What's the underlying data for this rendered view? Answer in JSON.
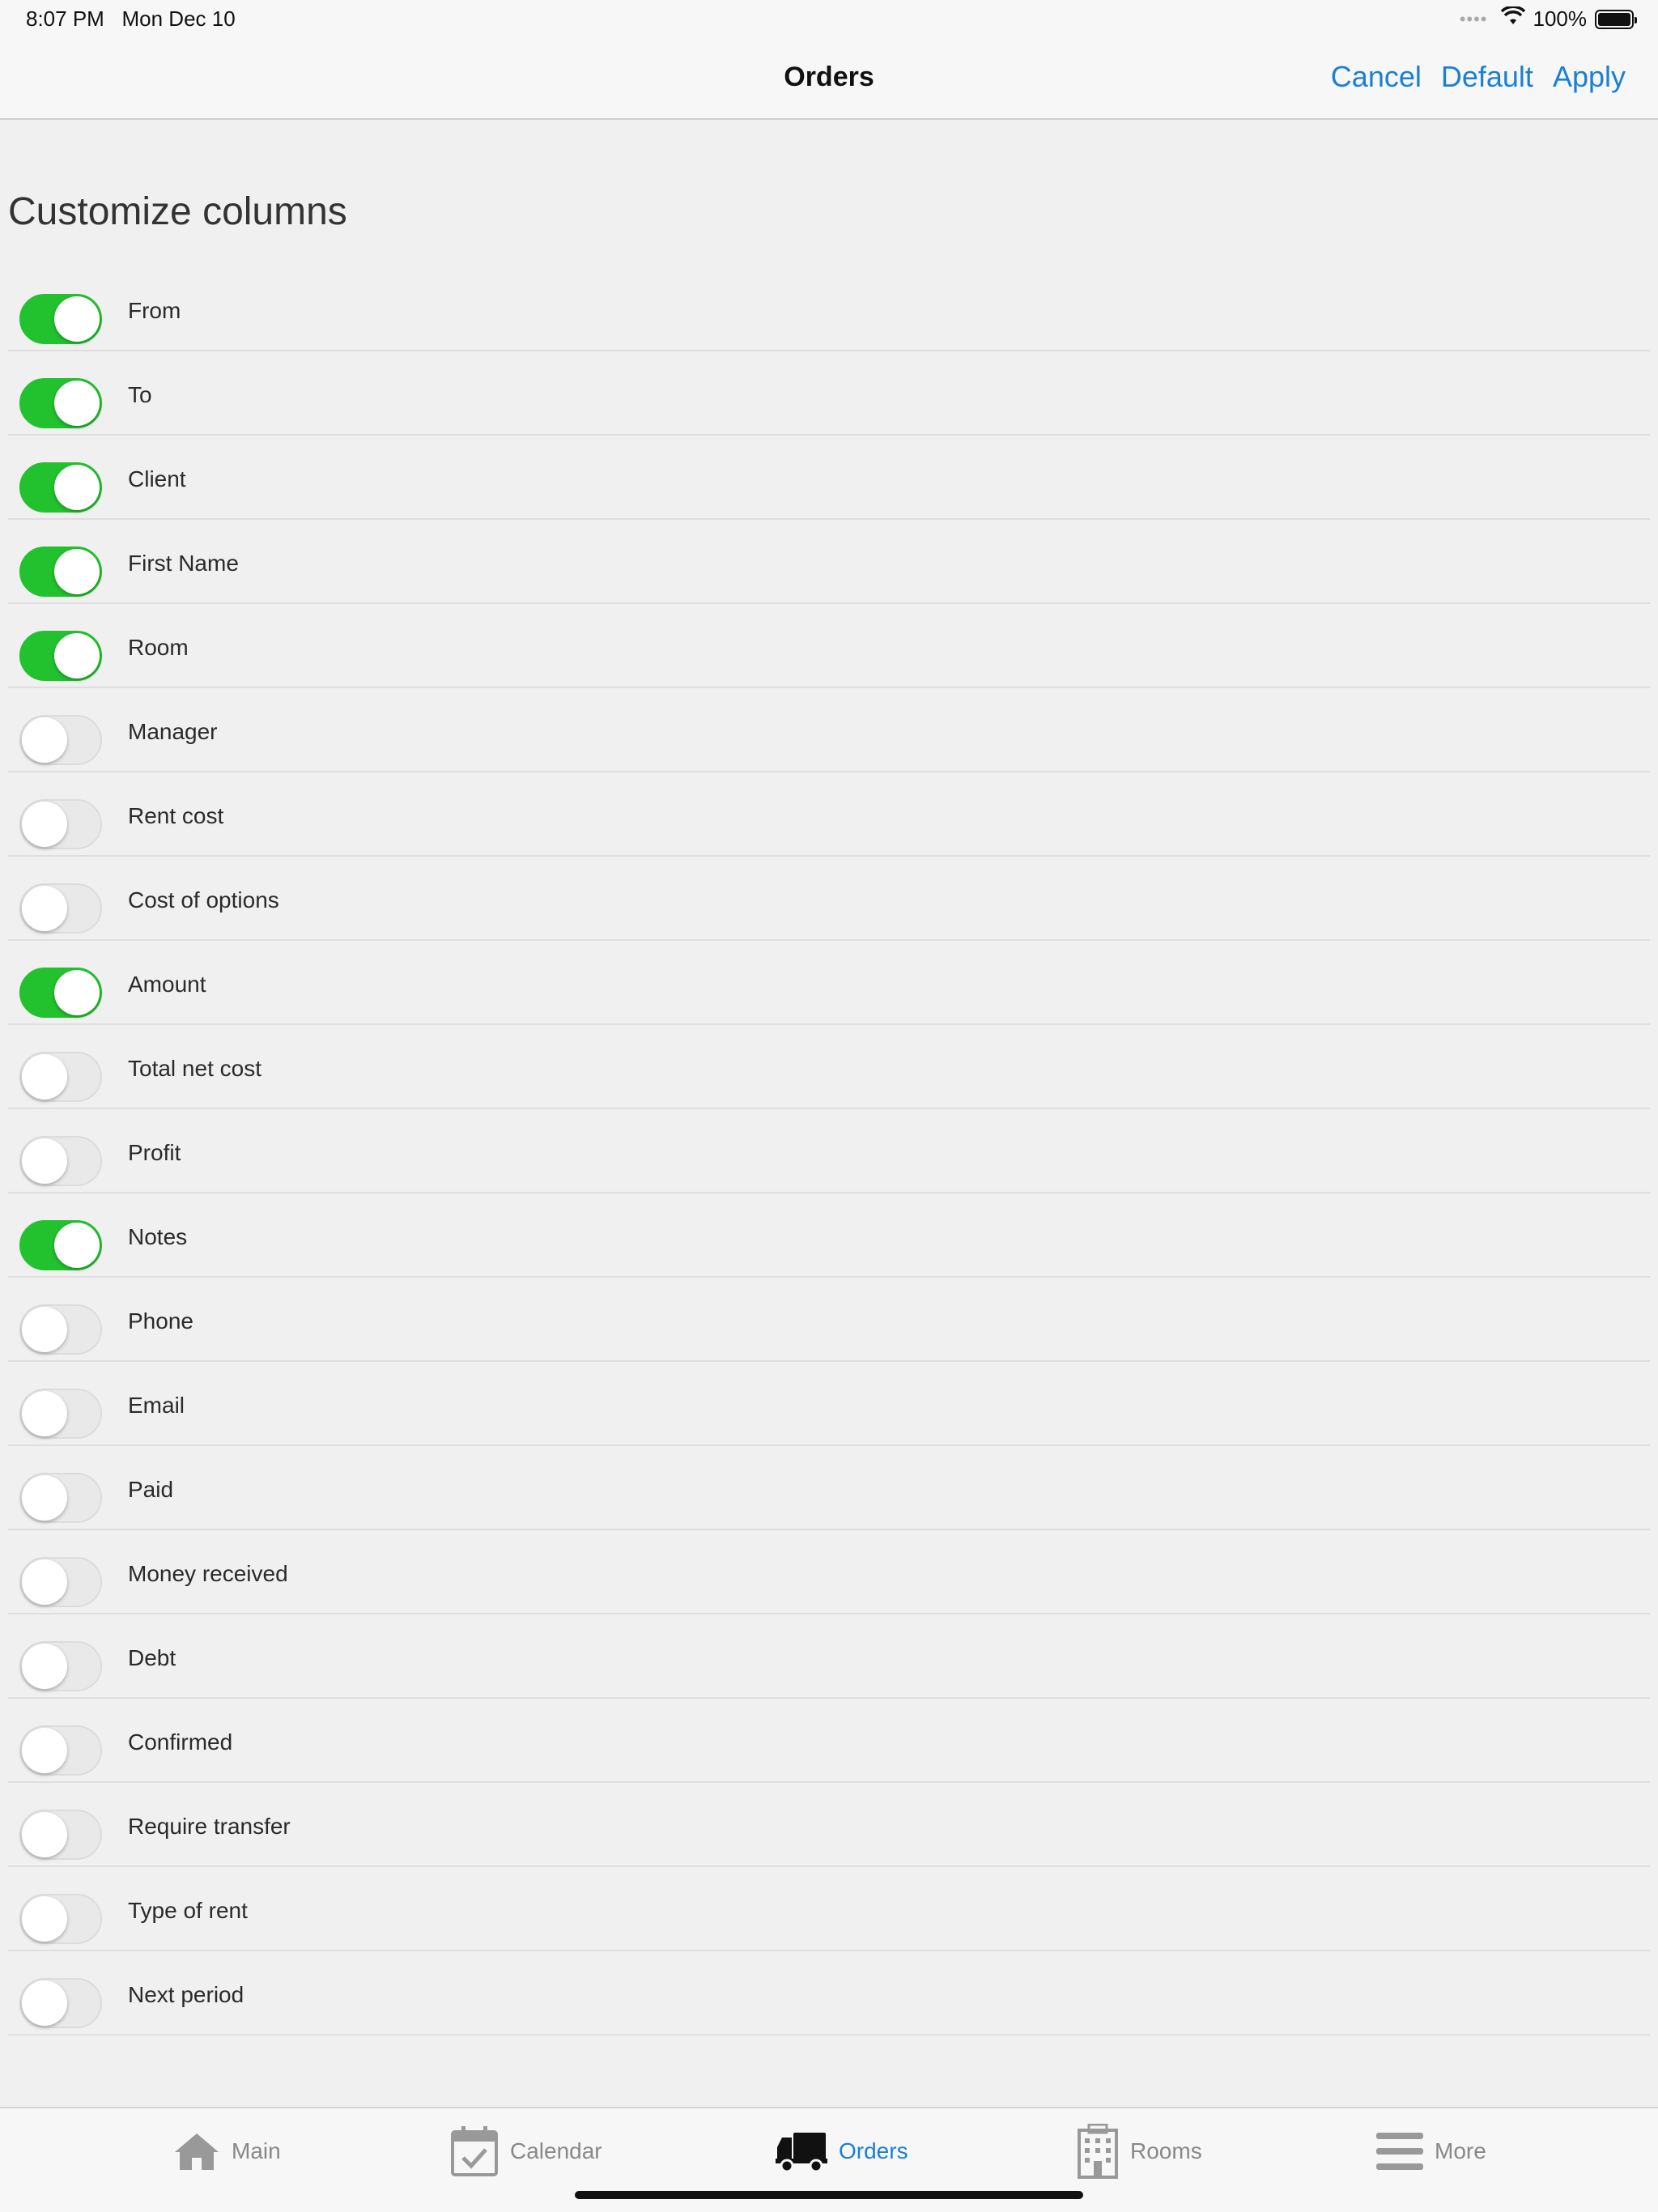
{
  "status_bar": {
    "time": "8:07 PM",
    "date": "Mon Dec 10",
    "battery": "100%"
  },
  "nav": {
    "title": "Orders",
    "cancel": "Cancel",
    "default": "Default",
    "apply": "Apply"
  },
  "section_title": "Customize columns",
  "columns": [
    {
      "label": "From",
      "on": true
    },
    {
      "label": "To",
      "on": true
    },
    {
      "label": "Client",
      "on": true
    },
    {
      "label": "First Name",
      "on": true
    },
    {
      "label": "Room",
      "on": true
    },
    {
      "label": "Manager",
      "on": false
    },
    {
      "label": "Rent cost",
      "on": false
    },
    {
      "label": "Cost of options",
      "on": false
    },
    {
      "label": "Amount",
      "on": true
    },
    {
      "label": "Total net cost",
      "on": false
    },
    {
      "label": "Profit",
      "on": false
    },
    {
      "label": "Notes",
      "on": true
    },
    {
      "label": "Phone",
      "on": false
    },
    {
      "label": "Email",
      "on": false
    },
    {
      "label": "Paid",
      "on": false
    },
    {
      "label": "Money received",
      "on": false
    },
    {
      "label": "Debt",
      "on": false
    },
    {
      "label": "Confirmed",
      "on": false
    },
    {
      "label": "Require transfer",
      "on": false
    },
    {
      "label": "Type of rent",
      "on": false
    },
    {
      "label": "Next period",
      "on": false
    }
  ],
  "tabs": [
    {
      "label": "Main",
      "icon": "home-icon",
      "active": false
    },
    {
      "label": "Calendar",
      "icon": "calendar-icon",
      "active": false
    },
    {
      "label": "Orders",
      "icon": "truck-icon",
      "active": true
    },
    {
      "label": "Rooms",
      "icon": "building-icon",
      "active": false
    },
    {
      "label": "More",
      "icon": "menu-icon",
      "active": false
    }
  ],
  "colors": {
    "accent": "#1a7fd6",
    "toggle_on": "#22c22e",
    "background": "#f0f0f0"
  }
}
